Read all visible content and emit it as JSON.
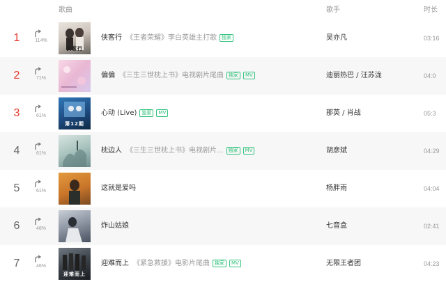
{
  "header": {
    "song": "歌曲",
    "singer": "歌手",
    "duration": "时长"
  },
  "badges": {
    "exclusive": "独家",
    "mv": "MV"
  },
  "colors": {
    "accent_green": "#31c27c",
    "rank_top": "#e4392b"
  },
  "songs": [
    {
      "rank": "1",
      "trend_icon": "arrow-up-icon",
      "trend": "114%",
      "title": "侠客行",
      "subtitle": "《王者荣耀》李白英雄主打歌",
      "exclusive": true,
      "mv": false,
      "singer": "吴亦凡",
      "duration": "03:16",
      "cover_text": "侠客行"
    },
    {
      "rank": "2",
      "trend_icon": "arrow-up-icon",
      "trend": "71%",
      "title": "偏偏",
      "subtitle": "《三生三世枕上书》电视剧片尾曲",
      "exclusive": true,
      "mv": true,
      "singer": "迪丽热巴 / 汪苏泷",
      "duration": "04:0",
      "cover_text": ""
    },
    {
      "rank": "3",
      "trend_icon": "arrow-up-icon",
      "trend": "61%",
      "title": "心动 (Live)",
      "subtitle": "",
      "exclusive": true,
      "mv": true,
      "singer": "那英 / 肖战",
      "duration": "05:3",
      "cover_text": "第12期"
    },
    {
      "rank": "4",
      "trend_icon": "arrow-up-icon",
      "trend": "61%",
      "title": "枕边人",
      "subtitle": "《三生三世枕上书》电视剧片...",
      "exclusive": true,
      "mv": true,
      "singer": "胡彦斌",
      "duration": "04:29",
      "cover_text": ""
    },
    {
      "rank": "5",
      "trend_icon": "arrow-up-icon",
      "trend": "61%",
      "title": "这就是爱吗",
      "subtitle": "",
      "exclusive": false,
      "mv": false,
      "singer": "杨胖雨",
      "duration": "04:04",
      "cover_text": ""
    },
    {
      "rank": "6",
      "trend_icon": "arrow-up-icon",
      "trend": "48%",
      "title": "炸山姑娘",
      "subtitle": "",
      "exclusive": false,
      "mv": false,
      "singer": "七音盒",
      "duration": "02:41",
      "cover_text": ""
    },
    {
      "rank": "7",
      "trend_icon": "arrow-up-icon",
      "trend": "46%",
      "title": "迎难而上",
      "subtitle": "《紧急救援》电影片尾曲",
      "exclusive": true,
      "mv": true,
      "singer": "无限王者团",
      "duration": "04:23",
      "cover_text": "迎难而上"
    }
  ]
}
